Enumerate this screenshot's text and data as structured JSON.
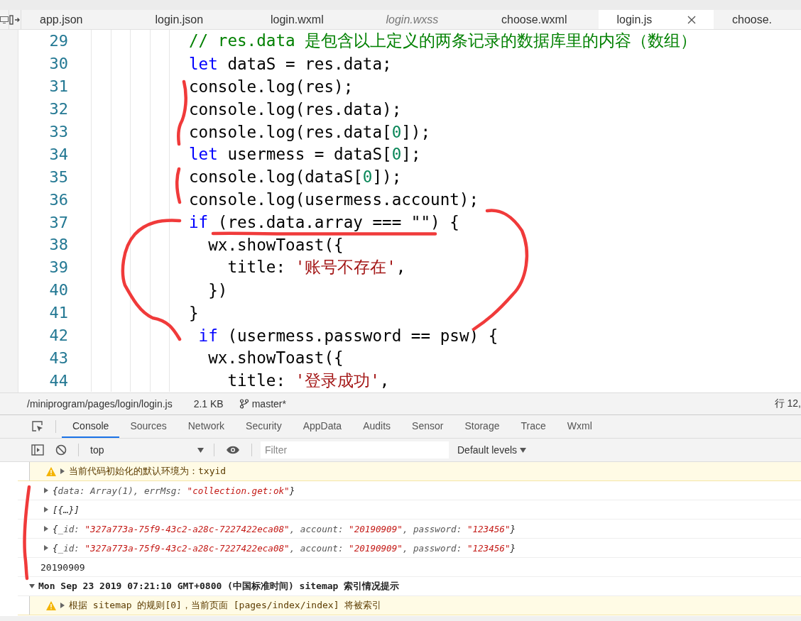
{
  "tabs": [
    {
      "label": "app.json",
      "selected": false,
      "preview": false
    },
    {
      "label": "login.json",
      "selected": false,
      "preview": false
    },
    {
      "label": "login.wxml",
      "selected": false,
      "preview": false
    },
    {
      "label": "login.wxss",
      "selected": false,
      "preview": true
    },
    {
      "label": "choose.wxml",
      "selected": false,
      "preview": false
    },
    {
      "label": "login.js",
      "selected": true,
      "preview": false
    },
    {
      "label": "choose.",
      "selected": false,
      "preview": false
    }
  ],
  "code_lines": [
    {
      "number": "29",
      "tokens": [
        {
          "kind": "comment",
          "text": "// res.data 是包含以上定义的两条记录的数据库里的内容（数组）"
        }
      ]
    },
    {
      "number": "30",
      "tokens": [
        {
          "kind": "keyword",
          "text": "let"
        },
        {
          "kind": "plain",
          "text": " dataS = res.data;"
        }
      ]
    },
    {
      "number": "31",
      "tokens": [
        {
          "kind": "plain",
          "text": "console.log(res);"
        }
      ]
    },
    {
      "number": "32",
      "tokens": [
        {
          "kind": "plain",
          "text": "console.log(res.data);"
        }
      ]
    },
    {
      "number": "33",
      "tokens": [
        {
          "kind": "plain",
          "text": "console.log(res.data["
        },
        {
          "kind": "number",
          "text": "0"
        },
        {
          "kind": "plain",
          "text": "]);"
        }
      ]
    },
    {
      "number": "34",
      "tokens": [
        {
          "kind": "keyword",
          "text": "let"
        },
        {
          "kind": "plain",
          "text": " usermess = dataS["
        },
        {
          "kind": "number",
          "text": "0"
        },
        {
          "kind": "plain",
          "text": "];"
        }
      ]
    },
    {
      "number": "35",
      "tokens": [
        {
          "kind": "plain",
          "text": "console.log(dataS["
        },
        {
          "kind": "number",
          "text": "0"
        },
        {
          "kind": "plain",
          "text": "]);"
        }
      ]
    },
    {
      "number": "36",
      "tokens": [
        {
          "kind": "plain",
          "text": "console.log(usermess.account);"
        }
      ]
    },
    {
      "number": "37",
      "tokens": [
        {
          "kind": "keyword",
          "text": "if"
        },
        {
          "kind": "plain",
          "text": " (res.data.array === \"\") {"
        }
      ]
    },
    {
      "number": "38",
      "tokens": [
        {
          "kind": "plain",
          "text": "  wx.showToast({"
        }
      ]
    },
    {
      "number": "39",
      "tokens": [
        {
          "kind": "plain",
          "text": "    title: "
        },
        {
          "kind": "string",
          "text": "'账号不存在'"
        },
        {
          "kind": "plain",
          "text": ","
        }
      ]
    },
    {
      "number": "40",
      "tokens": [
        {
          "kind": "plain",
          "text": "  })"
        }
      ]
    },
    {
      "number": "41",
      "tokens": [
        {
          "kind": "plain",
          "text": "}"
        }
      ]
    },
    {
      "number": "42",
      "tokens": [
        {
          "kind": "keyword",
          "text": " if"
        },
        {
          "kind": "plain",
          "text": " (usermess.password == psw) {"
        }
      ]
    },
    {
      "number": "43",
      "tokens": [
        {
          "kind": "plain",
          "text": "  wx.showToast({"
        }
      ]
    },
    {
      "number": "44",
      "tokens": [
        {
          "kind": "plain",
          "text": "    title: "
        },
        {
          "kind": "string",
          "text": "'登录成功'"
        },
        {
          "kind": "plain",
          "text": ","
        }
      ]
    }
  ],
  "status_bar": {
    "path": "/miniprogram/pages/login/login.js",
    "size": "2.1 KB",
    "branch": "master*",
    "position": "行 12,"
  },
  "devtools_tabs": [
    {
      "label": "Console",
      "selected": true
    },
    {
      "label": "Sources",
      "selected": false
    },
    {
      "label": "Network",
      "selected": false
    },
    {
      "label": "Security",
      "selected": false
    },
    {
      "label": "AppData",
      "selected": false
    },
    {
      "label": "Audits",
      "selected": false
    },
    {
      "label": "Sensor",
      "selected": false
    },
    {
      "label": "Storage",
      "selected": false
    },
    {
      "label": "Trace",
      "selected": false
    },
    {
      "label": "Wxml",
      "selected": false
    }
  ],
  "console_toolbar": {
    "context": "top",
    "filter_placeholder": "Filter",
    "levels": "Default levels"
  },
  "console_messages": [
    {
      "kind": "warning",
      "expanded": false,
      "text": "当前代码初始化的默认环境为：txyid"
    },
    {
      "kind": "object",
      "expanded": false,
      "tokens": [
        {
          "kind": "punct",
          "text": "{"
        },
        {
          "kind": "key",
          "text": "data: Array(1), errMsg: "
        },
        {
          "kind": "string",
          "text": "\"collection.get:ok\""
        },
        {
          "kind": "punct",
          "text": "}"
        }
      ]
    },
    {
      "kind": "object",
      "expanded": false,
      "tokens": [
        {
          "kind": "punct",
          "text": "[{…}]"
        }
      ]
    },
    {
      "kind": "object",
      "expanded": false,
      "tokens": [
        {
          "kind": "punct",
          "text": "{"
        },
        {
          "kind": "key",
          "text": "_id: "
        },
        {
          "kind": "string",
          "text": "\"327a773a-75f9-43c2-a28c-7227422eca08\""
        },
        {
          "kind": "key",
          "text": ", account: "
        },
        {
          "kind": "string",
          "text": "\"20190909\""
        },
        {
          "kind": "key",
          "text": ", password: "
        },
        {
          "kind": "string",
          "text": "\"123456\""
        },
        {
          "kind": "punct",
          "text": "}"
        }
      ]
    },
    {
      "kind": "object",
      "expanded": false,
      "tokens": [
        {
          "kind": "punct",
          "text": "{"
        },
        {
          "kind": "key",
          "text": "_id: "
        },
        {
          "kind": "string",
          "text": "\"327a773a-75f9-43c2-a28c-7227422eca08\""
        },
        {
          "kind": "key",
          "text": ", account: "
        },
        {
          "kind": "string",
          "text": "\"20190909\""
        },
        {
          "kind": "key",
          "text": ", password: "
        },
        {
          "kind": "string",
          "text": "\"123456\""
        },
        {
          "kind": "punct",
          "text": "}"
        }
      ]
    },
    {
      "kind": "text",
      "text": "20190909"
    },
    {
      "kind": "group",
      "expanded": true,
      "text": "Mon Sep 23 2019 07:21:10 GMT+0800 (中国标准时间) sitemap 索引情况提示"
    },
    {
      "kind": "warning",
      "expanded": false,
      "text": "根据 sitemap 的规则[0]，当前页面 [pages/index/index] 将被索引"
    }
  ]
}
